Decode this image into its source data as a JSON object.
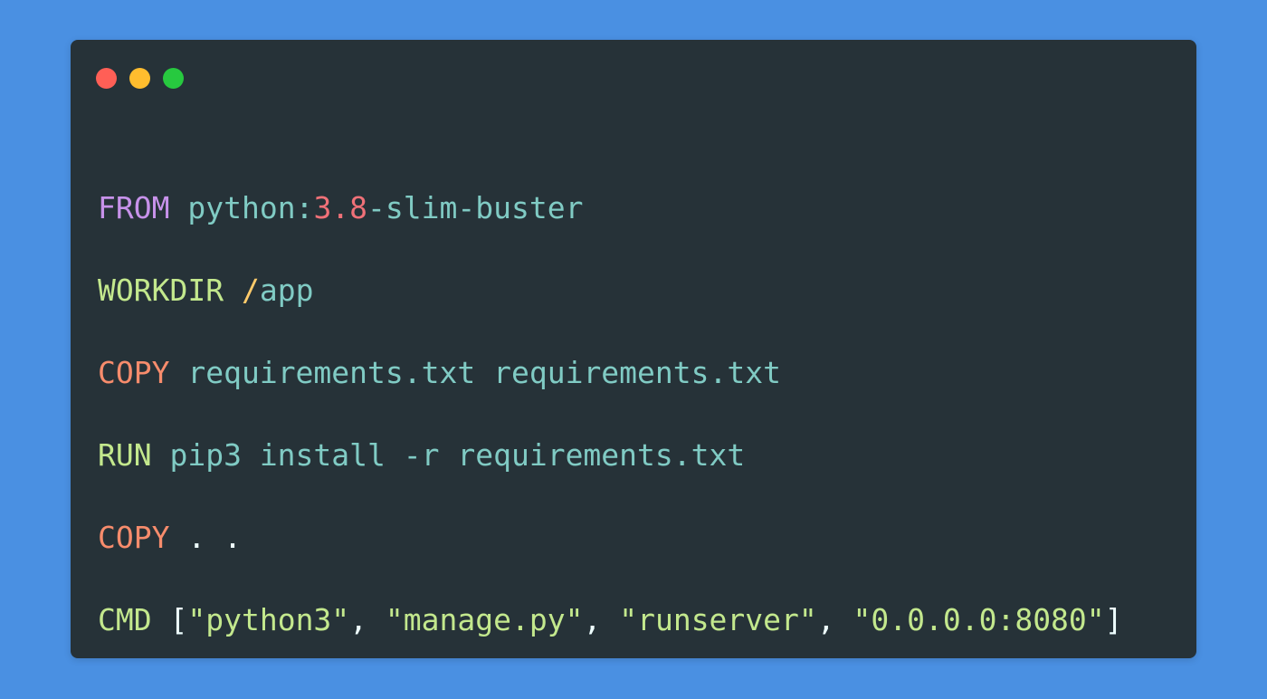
{
  "colors": {
    "background": "#4a90e2",
    "window": "#263238",
    "keyword_purple": "#c792ea",
    "keyword_green": "#c3e88d",
    "keyword_orange": "#f78c6c",
    "cyan": "#80cbc4",
    "number": "#f07178",
    "white": "#eeffff"
  },
  "window_controls": [
    "close-dot",
    "minimize-dot",
    "maximize-dot"
  ],
  "code_lines": [
    {
      "tokens": [
        {
          "text": "FROM",
          "color": "#c792ea"
        },
        {
          "text": " python:",
          "color": "#80cbc4"
        },
        {
          "text": "3.8",
          "color": "#f07178"
        },
        {
          "text": "-slim-buster",
          "color": "#80cbc4"
        }
      ]
    },
    {
      "tokens": [
        {
          "text": "WORKDIR",
          "color": "#c3e88d"
        },
        {
          "text": " ",
          "color": "#c3e88d"
        },
        {
          "text": "/",
          "color": "#ffcb6b"
        },
        {
          "text": "app",
          "color": "#80cbc4"
        }
      ]
    },
    {
      "tokens": [
        {
          "text": "COPY",
          "color": "#f78c6c"
        },
        {
          "text": " requirements.txt requirements.txt",
          "color": "#80cbc4"
        }
      ]
    },
    {
      "tokens": [
        {
          "text": "RUN",
          "color": "#c3e88d"
        },
        {
          "text": " pip3 install -r requirements.txt",
          "color": "#80cbc4"
        }
      ]
    },
    {
      "tokens": [
        {
          "text": "COPY",
          "color": "#f78c6c"
        },
        {
          "text": " . .",
          "color": "#eeffff"
        }
      ]
    },
    {
      "tokens": [
        {
          "text": "CMD",
          "color": "#c3e88d"
        },
        {
          "text": " [",
          "color": "#eeffff"
        },
        {
          "text": "\"python3\"",
          "color": "#c3e88d"
        },
        {
          "text": ", ",
          "color": "#eeffff"
        },
        {
          "text": "\"manage.py\"",
          "color": "#c3e88d"
        },
        {
          "text": ", ",
          "color": "#eeffff"
        },
        {
          "text": "\"runserver\"",
          "color": "#c3e88d"
        },
        {
          "text": ", ",
          "color": "#eeffff"
        },
        {
          "text": "\"0.0.0.0:8080\"",
          "color": "#c3e88d"
        },
        {
          "text": "]",
          "color": "#eeffff"
        }
      ]
    }
  ]
}
